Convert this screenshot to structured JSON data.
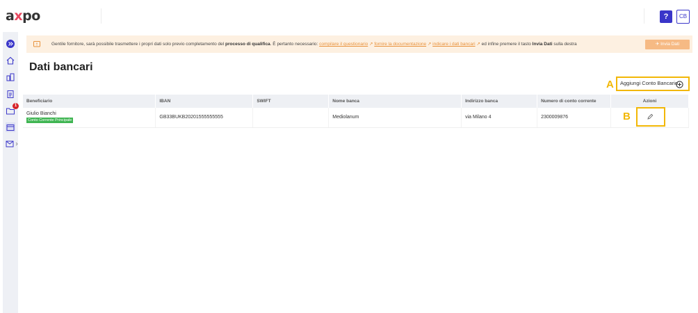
{
  "header": {
    "logo_left": "a",
    "logo_mid": "x",
    "logo_right": "po",
    "help_label": "?",
    "user_initials": "CB"
  },
  "sidebar": {
    "items": [
      {
        "icon": "expand-icon"
      },
      {
        "icon": "home-icon"
      },
      {
        "icon": "buildings-icon"
      },
      {
        "icon": "clipboard-icon"
      },
      {
        "icon": "folder-icon",
        "badge": "1"
      },
      {
        "icon": "wallet-icon",
        "active": true
      },
      {
        "icon": "mail-icon"
      }
    ]
  },
  "banner": {
    "text_1": "Gentile fornitore, sarà possibile trasmettere i propri dati solo previo completamento del ",
    "text_bold_1": "processo di qualifica",
    "text_2": ". È pertanto necessario: ",
    "link_1": "compilare il questionario",
    "link_2": "fornire la documentazione",
    "link_3": "indicare i dati bancari",
    "text_3": " ed infine premere il tasto ",
    "text_bold_2": "Invia Dati",
    "text_4": " sulla destra",
    "send_button": "Invia Dati"
  },
  "page": {
    "title": "Dati bancari",
    "add_account_label": "Aggiungi Conto Bancario",
    "marker_a": "A",
    "marker_b": "B"
  },
  "table": {
    "columns": [
      "Beneficiario",
      "IBAN",
      "SWIFT",
      "Nome banca",
      "Indirizzo banca",
      "Numero di conto corrente",
      "Azioni"
    ],
    "rows": [
      {
        "beneficiario": "Giulio Bianchi",
        "tag": "Conto Corrente Principale",
        "iban": "GB33BUKB20201555555555",
        "swift": "",
        "nome_banca": "Mediolanum",
        "indirizzo": "via Milano 4",
        "numero_conto": "2300009876"
      }
    ]
  },
  "colors": {
    "accent": "#3a36c9",
    "banner_bg": "#fdf0e1",
    "link": "#e8913a",
    "highlight": "#f2b705",
    "tag": "#3fb552"
  }
}
